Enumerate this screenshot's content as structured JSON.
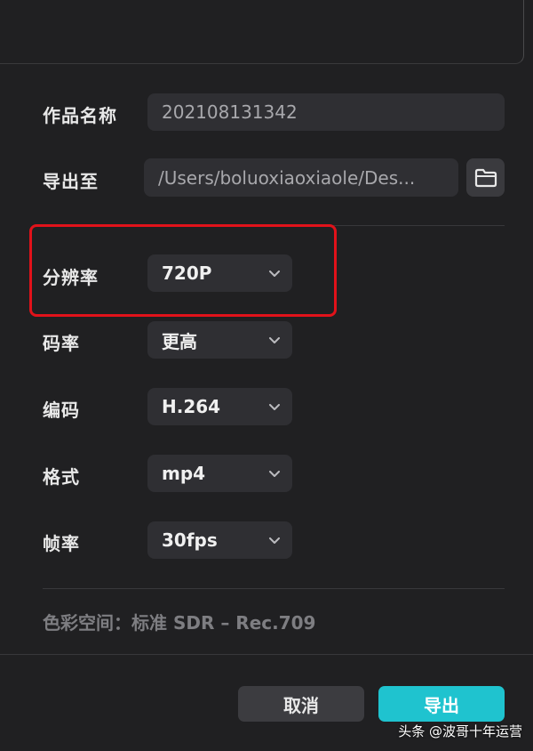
{
  "form": {
    "name_label": "作品名称",
    "name_value": "202108131342",
    "export_to_label": "导出至",
    "export_path": "/Users/boluoxiaoxiaole/Des...",
    "resolution_label": "分辨率",
    "resolution_value": "720P",
    "bitrate_label": "码率",
    "bitrate_value": "更高",
    "codec_label": "编码",
    "codec_value": "H.264",
    "format_label": "格式",
    "format_value": "mp4",
    "framerate_label": "帧率",
    "framerate_value": "30fps",
    "colorspace_text": "色彩空间：标准 SDR – Rec.709"
  },
  "buttons": {
    "cancel_label": "取消",
    "export_label": "导出"
  },
  "watermark": {
    "text": "头条 @波哥十年运营"
  },
  "colors": {
    "accent": "#1fc3cf",
    "highlight_border": "#e1121a"
  }
}
